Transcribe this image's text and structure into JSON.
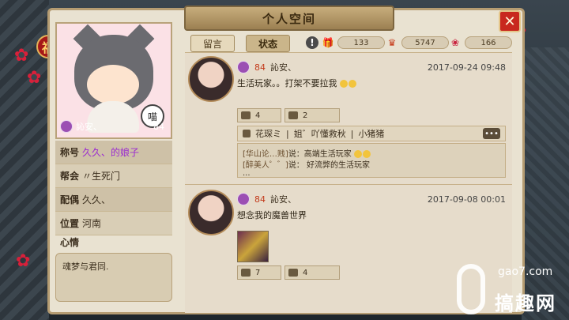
{
  "window": {
    "title": "个人空间",
    "close_icon": "close-x-icon"
  },
  "profile": {
    "name": "訫安、",
    "level": "84",
    "avatar_tag": "喵",
    "fields": [
      {
        "key": "称号",
        "value": "久久、的娘子"
      },
      {
        "key": "帮会",
        "value": "〃生死门"
      },
      {
        "key": "配偶",
        "value": "久久、"
      },
      {
        "key": "位置",
        "value": "河南"
      }
    ],
    "mood_label": "心情",
    "mood_text": "魂梦与君同."
  },
  "tabs": [
    {
      "label": "留言"
    },
    {
      "label": "状态",
      "active": true
    }
  ],
  "stats": {
    "gifts": "133",
    "crowns": "5747",
    "roses": "166"
  },
  "posts": [
    {
      "name": "訫安、",
      "level": "84",
      "time": "2017-09-24 09:48",
      "text": "生活玩家。。打架不要拉我",
      "likes": "4",
      "comments_count": "2",
      "likers": [
        "花琛ミ",
        "姐゛吖懂救秋",
        "小猪猪"
      ],
      "more_label": "•••",
      "comments": [
        {
          "name": "[华山论…贱]",
          "text": "说：高端生活玩家"
        },
        {
          "name": "[醉美人゜゛]",
          "text": "说：     好流弊的生活玩家"
        }
      ],
      "ellipsis": "..."
    },
    {
      "name": "訫安、",
      "level": "84",
      "time": "2017-09-08 00:01",
      "text": "想念我的魔兽世界",
      "likes": "7",
      "comments_count": "4"
    }
  ],
  "watermark": {
    "site": "gao7.com",
    "name": "搞趣网"
  },
  "colors": {
    "title_gold": "#c7ad7c",
    "close_red": "#c8281e",
    "purple_title": "#9b2bd0",
    "level_red": "#c33b1c"
  }
}
